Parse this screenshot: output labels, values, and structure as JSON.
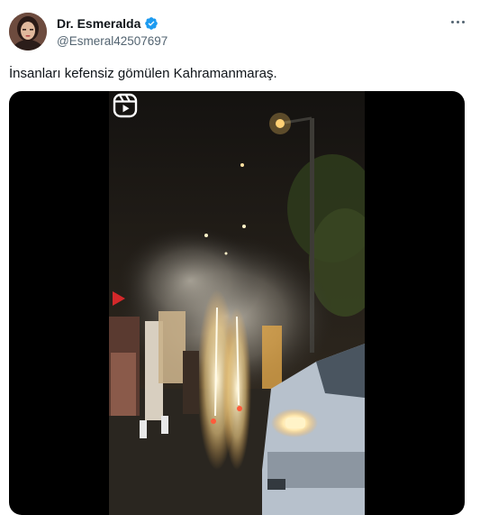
{
  "author": {
    "display_name": "Dr. Esmeralda",
    "handle": "@Esmeral42507697",
    "verified": true,
    "verified_color": "#1d9bf0"
  },
  "tweet": {
    "text": "İnsanları kefensiz gömülen Kahramanmaraş."
  },
  "icons": {
    "more": "more-options-icon",
    "verified": "verified-badge-icon",
    "reels": "instagram-reels-icon"
  }
}
